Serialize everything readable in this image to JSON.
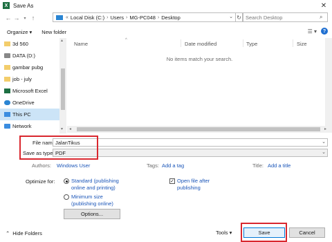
{
  "window": {
    "title": "Save As",
    "app_icon_letter": "X",
    "close_glyph": "✕"
  },
  "nav": {
    "back_glyph": "←",
    "forward_glyph": "→",
    "up_glyph": "↑",
    "breadcrumbs": [
      "Local Disk (C:)",
      "Users",
      "MG-PC048",
      "Desktop"
    ],
    "crumb_prefix": "«",
    "search_placeholder": "Search Desktop"
  },
  "toolbar": {
    "organize_label": "Organize ▾",
    "new_folder_label": "New folder",
    "view_glyph": "☰ ▾",
    "help_glyph": "?"
  },
  "sidebar": {
    "items": [
      {
        "label": "3d 560",
        "icon": "folder-icon"
      },
      {
        "label": "DATA (D:)",
        "icon": "drive-icon"
      },
      {
        "label": "gambar pubg",
        "icon": "folder-icon"
      },
      {
        "label": "job - july",
        "icon": "folder-icon"
      },
      {
        "label": "Microsoft Excel",
        "icon": "excel-icon"
      },
      {
        "label": "OneDrive",
        "icon": "onedrive-icon"
      },
      {
        "label": "This PC",
        "icon": "pc-icon"
      },
      {
        "label": "Network",
        "icon": "network-icon"
      }
    ]
  },
  "filelist": {
    "columns": [
      "Name",
      "Date modified",
      "Type",
      "Size"
    ],
    "empty_message": "No items match your search."
  },
  "form": {
    "file_name_label": "File name:",
    "file_name_value": "JalanTikus",
    "save_type_label": "Save as type:",
    "save_type_value": "PDF",
    "authors_label": "Authors:",
    "authors_value": "Windows User",
    "tags_label": "Tags:",
    "tags_value": "Add a tag",
    "title_label": "Title:",
    "title_value": "Add a title",
    "optimize_label": "Optimize for:",
    "opt_standard": "Standard (publishing online and printing)",
    "opt_minimum": "Minimum size (publishing online)",
    "open_after_label": "Open file after publishing",
    "options_button": "Options...",
    "checkmark": "✓"
  },
  "footer": {
    "hide_folders_label": "Hide Folders",
    "hide_folders_glyph": "⌃",
    "tools_label": "Tools ▾",
    "save_label": "Save",
    "cancel_label": "Cancel"
  },
  "colors": {
    "highlight_red": "#d9262e",
    "accent_blue": "#0078d7",
    "selected_bg": "#cce4f7"
  }
}
